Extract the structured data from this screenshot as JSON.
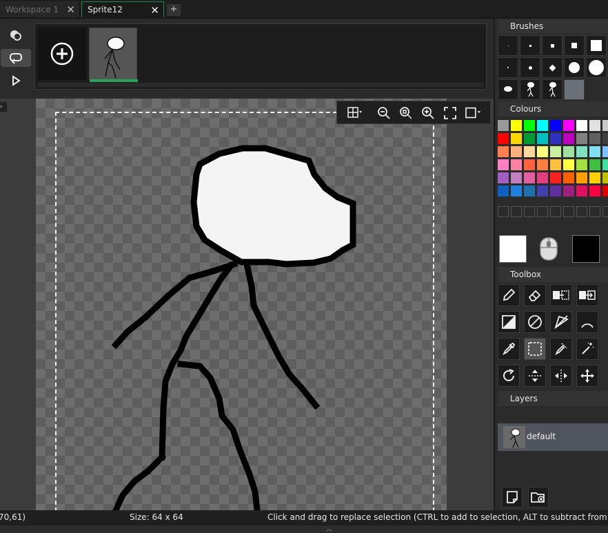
{
  "tabs": [
    {
      "label": "Workspace 1",
      "active": false
    },
    {
      "label": "Sprite12",
      "active": true
    }
  ],
  "tab_add_label": "+",
  "panels": {
    "brushes": "Brushes",
    "colours": "Colours",
    "toolbox": "Toolbox",
    "layers": "Layers"
  },
  "colours": {
    "primary": "#ffffff",
    "secondary": "#000000",
    "palette_rows": [
      [
        "#9a9a9a",
        "#ffff00",
        "#00ff00",
        "#00ffff",
        "#0000ff",
        "#ff00ff",
        "#ffffff",
        "#e0e0e0",
        "#c8c8c8"
      ],
      [
        "#ff0000",
        "#ffd700",
        "#009933",
        "#00c0c0",
        "#3030c0",
        "#c000c0",
        "#808080",
        "#606060",
        "#404040"
      ],
      [
        "#ff7f50",
        "#ffb07c",
        "#ffd8a0",
        "#ffff80",
        "#c8f0a0",
        "#a0e0a0",
        "#80e0c0",
        "#80e0f0",
        "#80c0ff"
      ],
      [
        "#ff80c0",
        "#ff80a0",
        "#ff6040",
        "#ff8040",
        "#ffc040",
        "#ffff40",
        "#a0e040",
        "#40c040",
        "#40e0a0"
      ],
      [
        "#a060c0",
        "#c080c0",
        "#e060a0",
        "#e04080",
        "#ff2020",
        "#ff6000",
        "#ffa000",
        "#ffd000",
        "#c0c000"
      ],
      [
        "#1060c0",
        "#2080e0",
        "#2070b0",
        "#4040b0",
        "#6030a0",
        "#a02080",
        "#e01060",
        "#ff0040",
        "#e00000"
      ]
    ]
  },
  "layers": [
    {
      "name": "default"
    }
  ],
  "status": {
    "coords": "70,61)",
    "size": "Size: 64 x 64",
    "hint": "Click and drag to replace selection (CTRL to add to selection, ALT to subtract from selection)"
  }
}
